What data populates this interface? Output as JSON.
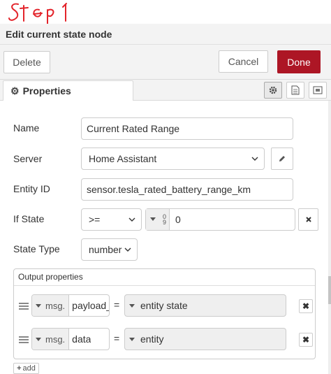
{
  "annotation": {
    "text": "Step 1",
    "color": "#e3242b"
  },
  "tray": {
    "title": "Edit current state node"
  },
  "toolbar": {
    "delete_label": "Delete",
    "cancel_label": "Cancel",
    "done_label": "Done",
    "done_color": "#ad1625"
  },
  "tabs": {
    "properties_label": "Properties"
  },
  "form": {
    "name": {
      "label": "Name",
      "value": "Current Rated Range"
    },
    "server": {
      "label": "Server",
      "value": "Home Assistant"
    },
    "entity_id": {
      "label": "Entity ID",
      "value": "sensor.tesla_rated_battery_range_km"
    },
    "if_state": {
      "label": "If State",
      "operator": ">=",
      "type_glyph": "0\n9",
      "value": "0"
    },
    "state_type": {
      "label": "State Type",
      "value": "number"
    }
  },
  "output_properties": {
    "header": "Output properties",
    "rows": [
      {
        "prefix": "msg.",
        "property": "payload_r",
        "equals": "=",
        "value": "entity state"
      },
      {
        "prefix": "msg.",
        "property": "data",
        "equals": "=",
        "value": "entity"
      }
    ],
    "add_label": "add"
  }
}
